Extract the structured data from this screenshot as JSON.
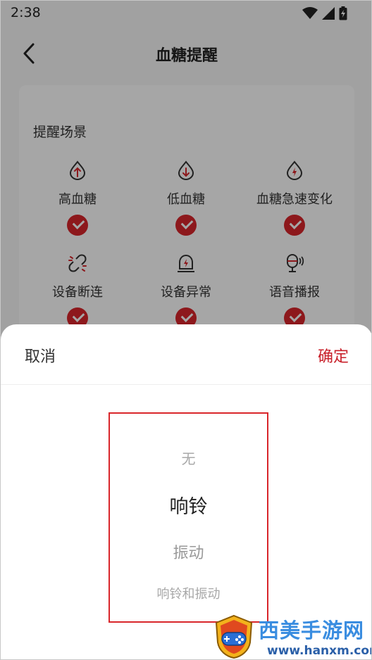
{
  "status_bar": {
    "time": "2:38",
    "icons": [
      "wifi-icon",
      "signal-icon",
      "battery-icon"
    ]
  },
  "header": {
    "title": "血糖提醒",
    "back_icon": "chevron-left-icon"
  },
  "card": {
    "section_title": "提醒场景",
    "options": [
      {
        "label": "高血糖",
        "icon": "drop-up-arrow-icon",
        "checked": true
      },
      {
        "label": "低血糖",
        "icon": "drop-down-arrow-icon",
        "checked": true
      },
      {
        "label": "血糖急速变化",
        "icon": "drop-lightning-icon",
        "checked": true
      },
      {
        "label": "设备断连",
        "icon": "broken-link-icon",
        "checked": true
      },
      {
        "label": "设备异常",
        "icon": "device-alert-icon",
        "checked": true
      },
      {
        "label": "语音播报",
        "icon": "voice-mic-icon",
        "checked": true
      }
    ]
  },
  "sheet": {
    "cancel_label": "取消",
    "confirm_label": "确定",
    "picker_items": [
      "无",
      "响铃",
      "振动",
      "响铃和振动"
    ],
    "selected": "响铃"
  },
  "watermark": {
    "text": "西美手游网",
    "url": "www.hanxm.com"
  },
  "colors": {
    "accent": "#d9262b",
    "confirm": "#c8202a",
    "watermark": "#3a8de0"
  }
}
